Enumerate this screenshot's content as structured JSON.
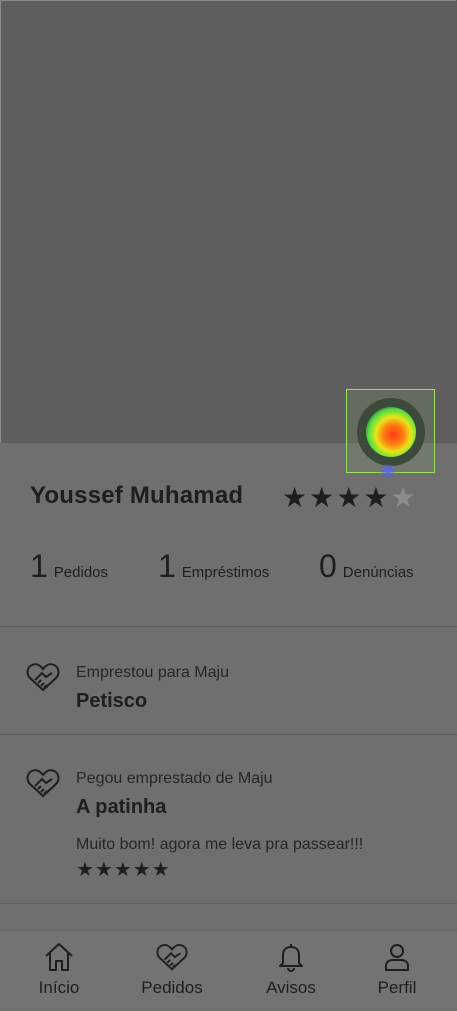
{
  "profile": {
    "name": "Youssef Muhamad",
    "rating_stars": 4,
    "rating_max": 5
  },
  "stats": [
    {
      "value": "1",
      "label": "Pedidos"
    },
    {
      "value": "1",
      "label": "Empréstimos"
    },
    {
      "value": "0",
      "label": "Denúncias"
    }
  ],
  "activity": [
    {
      "subtitle": "Emprestou para Maju",
      "title": "Petisco",
      "icon": "handshake-heart-icon"
    },
    {
      "subtitle": "Pegou emprestado de Maju",
      "title": "A patinha",
      "comment": "Muito bom! agora me leva pra passear!!!",
      "review_stars": 5,
      "icon": "handshake-heart-icon"
    }
  ],
  "nav": {
    "inicio": "Início",
    "pedidos": "Pedidos",
    "avisos": "Avisos",
    "perfil": "Perfil"
  },
  "colors": {
    "overlay": "#6f6f6f",
    "hero": "#5f5f5f",
    "text": "#1e1e1e"
  }
}
